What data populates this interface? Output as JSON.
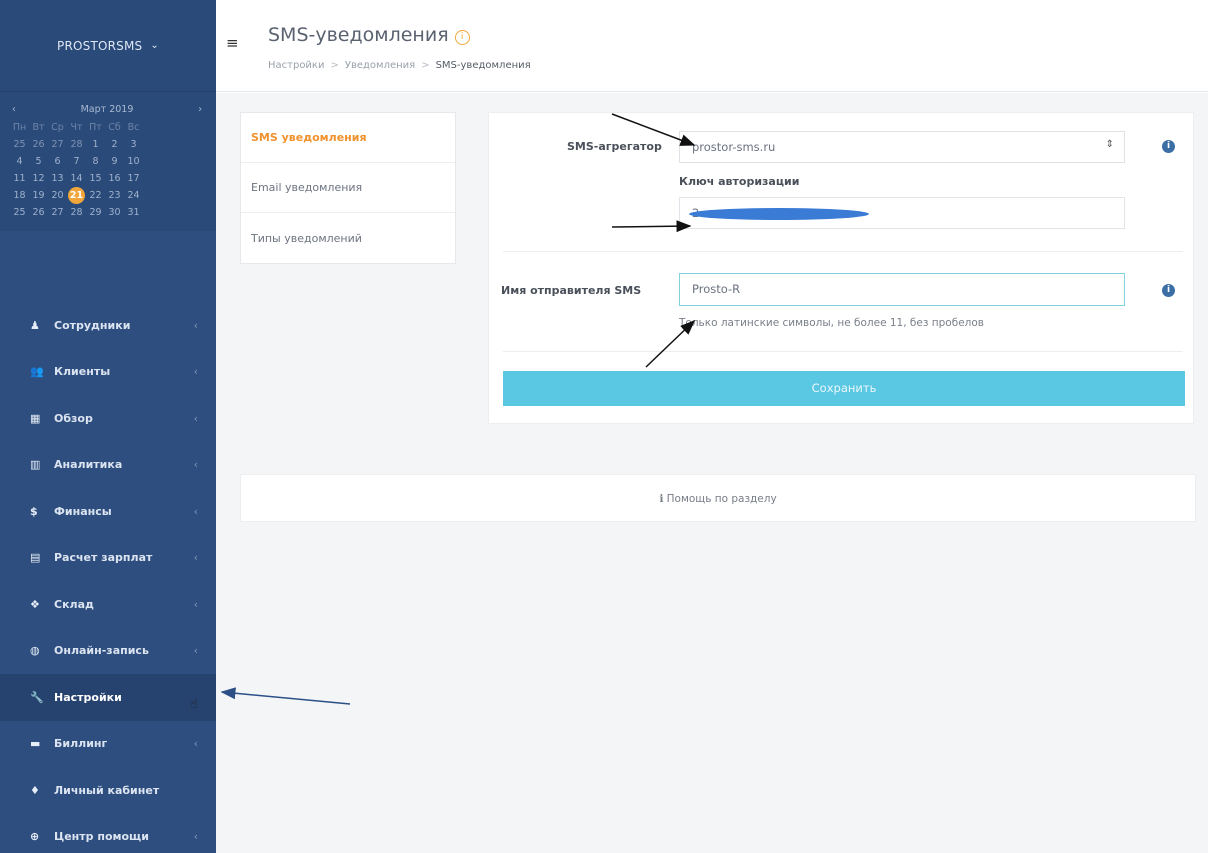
{
  "sidebar": {
    "brand": "PROSTORSMS",
    "calendar": {
      "month": "Март 2019",
      "weekdays": [
        "Пн",
        "Вт",
        "Ср",
        "Чт",
        "Пт",
        "Сб",
        "Вс"
      ],
      "weeks": [
        [
          "25",
          "26",
          "27",
          "28",
          "1",
          "2",
          "3"
        ],
        [
          "4",
          "5",
          "6",
          "7",
          "8",
          "9",
          "10"
        ],
        [
          "11",
          "12",
          "13",
          "14",
          "15",
          "16",
          "17"
        ],
        [
          "18",
          "19",
          "20",
          "21",
          "22",
          "23",
          "24"
        ],
        [
          "25",
          "26",
          "27",
          "28",
          "29",
          "30",
          "31"
        ]
      ],
      "today": "21"
    },
    "items": [
      {
        "label": "Сотрудники",
        "icon": "user-icon"
      },
      {
        "label": "Клиенты",
        "icon": "users-icon"
      },
      {
        "label": "Обзор",
        "icon": "grid-icon"
      },
      {
        "label": "Аналитика",
        "icon": "bar-chart-icon"
      },
      {
        "label": "Финансы",
        "icon": "dollar-icon"
      },
      {
        "label": "Расчет зарплат",
        "icon": "payroll-icon"
      },
      {
        "label": "Склад",
        "icon": "cubes-icon"
      },
      {
        "label": "Онлайн-запись",
        "icon": "globe-icon"
      },
      {
        "label": "Настройки",
        "icon": "wrench-icon"
      },
      {
        "label": "Биллинг",
        "icon": "credit-card-icon"
      },
      {
        "label": "Личный кабинет",
        "icon": "person-icon"
      },
      {
        "label": "Центр помощи",
        "icon": "lifebuoy-icon"
      }
    ]
  },
  "header": {
    "title": "SMS-уведомления",
    "breadcrumb": [
      "Настройки",
      "Уведомления",
      "SMS-уведомления"
    ]
  },
  "tabs": [
    "SMS уведомления",
    "Email уведомления",
    "Типы уведомлений"
  ],
  "form": {
    "aggregator_label": "SMS-агрегатор",
    "aggregator_value": "prostor-sms.ru",
    "auth_key_label": "Ключ авторизации",
    "auth_key_value": "2",
    "sender_label": "Имя отправителя SMS",
    "sender_value": "Prosto-R",
    "sender_help": "Только латинские символы, не более 11, без пробелов",
    "save_label": "Сохранить"
  },
  "help_link": "Помощь по разделу",
  "colors": {
    "sidebar": "#2d4e7e",
    "accent_orange": "#f0a63a",
    "save_button": "#5bc8e3",
    "active_tab": "#f0922e"
  }
}
